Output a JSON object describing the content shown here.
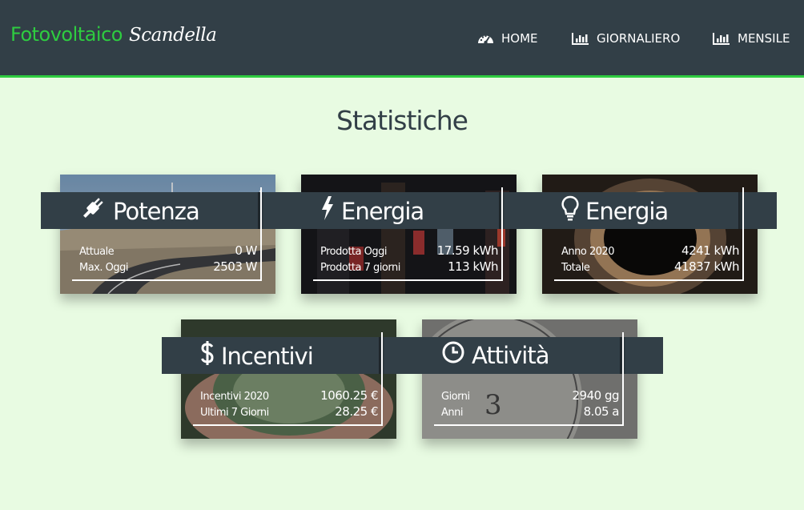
{
  "header": {
    "brand_primary": "Fotovoltaico",
    "brand_secondary": "Scandella",
    "nav": [
      {
        "label": "HOME",
        "icon": "dashboard-gauge-icon"
      },
      {
        "label": "GIORNALIERO",
        "icon": "bar-chart-icon"
      },
      {
        "label": "MENSILE",
        "icon": "bar-chart-icon"
      }
    ],
    "accent": "#2ecc40",
    "background": "#323f47"
  },
  "page": {
    "title": "Statistiche",
    "background": "#e8fbe2"
  },
  "cards": [
    {
      "title": "Potenza",
      "icon": "plug-icon",
      "rows": [
        {
          "label": "Attuale",
          "value": "0 W"
        },
        {
          "label": "Max. Oggi",
          "value": "2503 W"
        }
      ]
    },
    {
      "title": "Energia",
      "icon": "lightning-bolt-icon",
      "rows": [
        {
          "label": "Prodotta Oggi",
          "value": "17.59 kWh"
        },
        {
          "label": "Prodotta 7 giorni",
          "value": "113 kWh"
        }
      ]
    },
    {
      "title": "Energia",
      "icon": "lightbulb-icon",
      "rows": [
        {
          "label": "Anno 2020",
          "value": "4241 kWh"
        },
        {
          "label": "Totale",
          "value": "41837 kWh"
        }
      ]
    },
    {
      "title": "Incentivi",
      "icon": "dollar-icon",
      "rows": [
        {
          "label": "Incentivi 2020",
          "value": "1060.25 €"
        },
        {
          "label": "Ultimi 7 Giorni",
          "value": "28.25 €"
        }
      ]
    },
    {
      "title": "Attività",
      "icon": "clock-icon",
      "rows": [
        {
          "label": "Giorni",
          "value": "2940 gg"
        },
        {
          "label": "Anni",
          "value": "8.05 a"
        }
      ]
    }
  ]
}
